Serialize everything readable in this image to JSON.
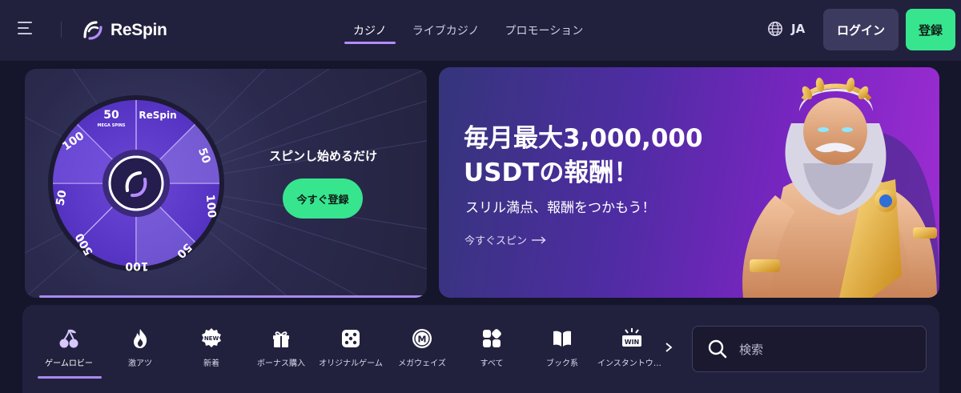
{
  "header": {
    "brand": "ReSpin",
    "tabs": [
      {
        "label": "カジノ",
        "active": true
      },
      {
        "label": "ライブカジノ",
        "active": false
      },
      {
        "label": "プロモーション",
        "active": false
      }
    ],
    "language": "JA",
    "login_label": "ログイン",
    "register_label": "登録"
  },
  "promo_left": {
    "wheel_brand": "ReSpin",
    "wheel_values": [
      "50",
      "50",
      "100",
      "50",
      "100",
      "500",
      "50",
      "100"
    ],
    "wheel_caption": "MEGA SPINS",
    "title": "スピンし始めるだけ",
    "cta_label": "今すぐ登録"
  },
  "promo_right": {
    "headline": "毎月最大3,000,000\nUSDTの報酬！",
    "subtitle": "スリル満点、報酬をつかもう！",
    "link_label": "今すぐスピン"
  },
  "categories": {
    "items": [
      {
        "label": "ゲームロビー",
        "icon": "cherry-icon",
        "active": true
      },
      {
        "label": "激アツ",
        "icon": "flame-icon"
      },
      {
        "label": "新着",
        "icon": "new-badge-icon",
        "badge": "NEW"
      },
      {
        "label": "ボーナス購入",
        "icon": "gift-icon"
      },
      {
        "label": "オリジナルゲーム",
        "icon": "dice-icon"
      },
      {
        "label": "メガウェイズ",
        "icon": "megaways-icon",
        "badge": "M"
      },
      {
        "label": "すべて",
        "icon": "grid-icon"
      },
      {
        "label": "ブック系",
        "icon": "book-icon"
      },
      {
        "label": "インスタントウィン",
        "icon": "instant-win-icon",
        "badge": "WIN"
      }
    ],
    "search_placeholder": "検索"
  },
  "colors": {
    "background": "#15152b",
    "header": "#22213d",
    "accent_purple": "#b48cff",
    "register_green": "#37e58f",
    "login_bg": "#3d3a60"
  }
}
